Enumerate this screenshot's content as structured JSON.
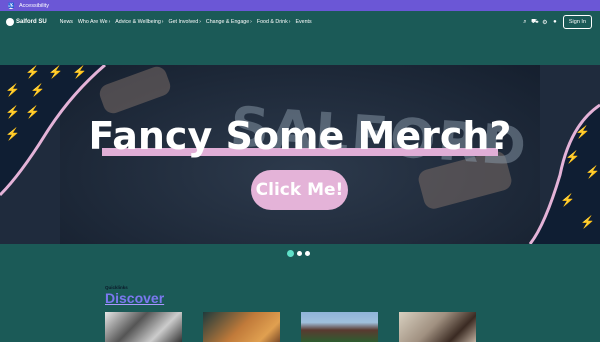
{
  "accessibility": {
    "label": "Accessibility",
    "icon": "accessibility-icon"
  },
  "header": {
    "logo_text": "Salford SU",
    "nav": [
      {
        "label": "News",
        "has_menu": false
      },
      {
        "label": "Who Are We",
        "has_menu": true
      },
      {
        "label": "Advice & Wellbeing",
        "has_menu": true
      },
      {
        "label": "Get Involved",
        "has_menu": true
      },
      {
        "label": "Change & Engage",
        "has_menu": true
      },
      {
        "label": "Food & Drink",
        "has_menu": true
      },
      {
        "label": "Events",
        "has_menu": false
      }
    ],
    "chevron": "›",
    "tools": {
      "search": "⌕",
      "basket": "⛟",
      "settings": "⚙",
      "account": "●"
    },
    "sign_in": "Sign In"
  },
  "hero": {
    "title": "Fancy Some Merch?",
    "cta": "Click Me!",
    "shirt_text": "SALFORD"
  },
  "carousel": {
    "count": 3,
    "active": 0
  },
  "quicklinks": {
    "kicker": "Quicklinks",
    "title": "Discover"
  },
  "colors": {
    "page_bg": "#1b5a57",
    "accessibility_bar": "#6b57d6",
    "accent_pink": "#e4b3d8",
    "dot_active": "#5fe0c8",
    "discover": "#7b78f0"
  }
}
